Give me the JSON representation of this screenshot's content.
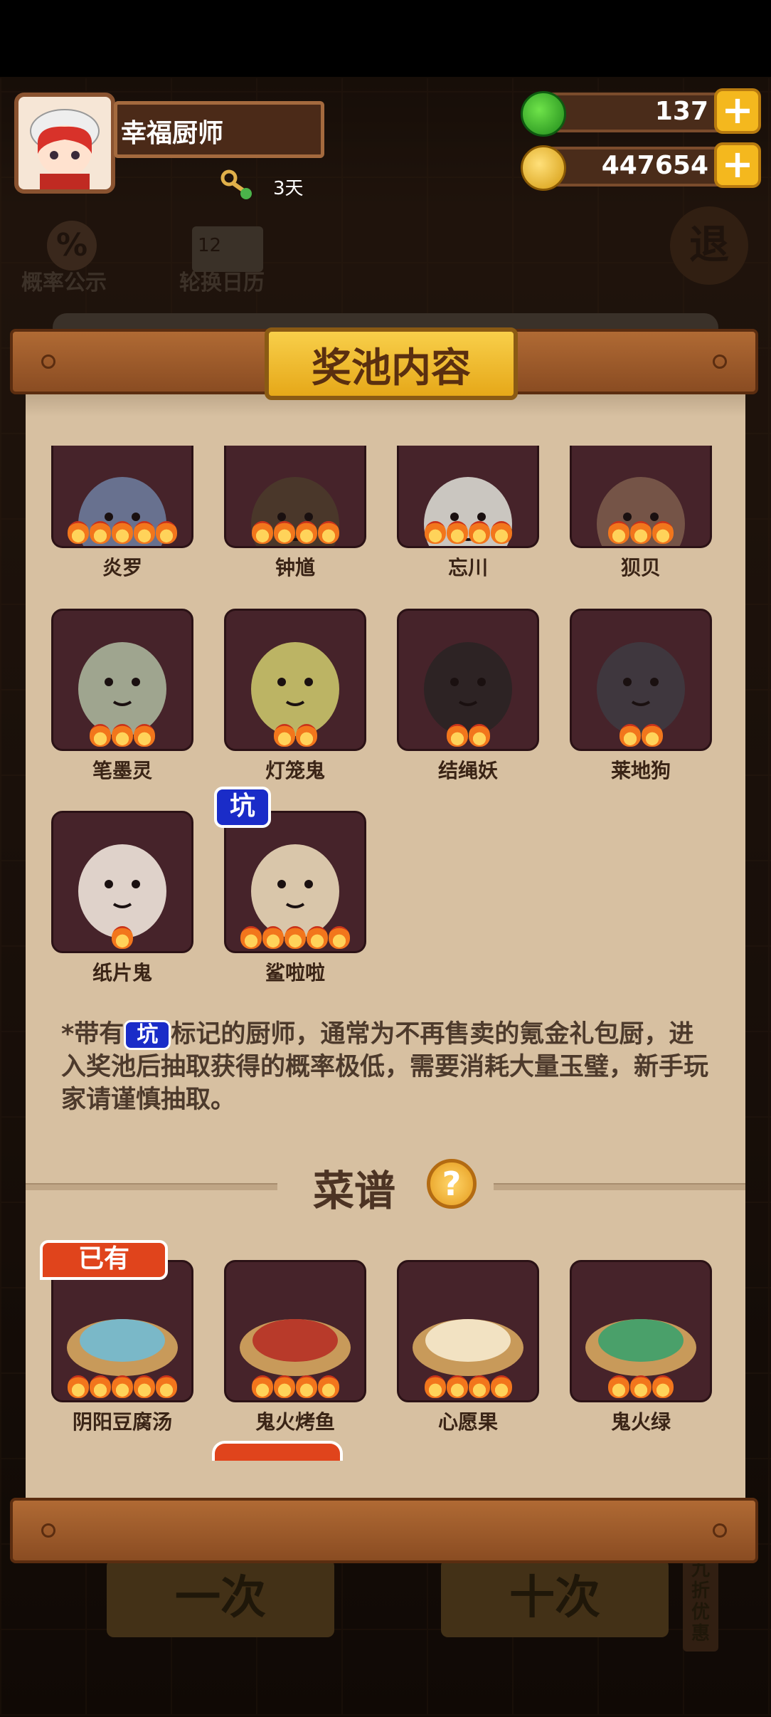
{
  "header": {
    "player_name": "幸福厨师",
    "days": "3天",
    "jade_amount": "137",
    "coin_amount": "447654",
    "plus": "+"
  },
  "background": {
    "prob_label": "概率公示",
    "calendar_label": "轮换日历",
    "calendar_num": "12",
    "exit_label": "退",
    "discount_label": "九折优惠",
    "draw_once": "一次",
    "draw_ten": "十次"
  },
  "panel": {
    "title": "奖池内容",
    "chefs": [
      {
        "name": "炎罗",
        "stars": 5
      },
      {
        "name": "钟馗",
        "stars": 4
      },
      {
        "name": "忘川",
        "stars": 4
      },
      {
        "name": "狈贝",
        "stars": 3
      },
      {
        "name": "笔墨灵",
        "stars": 3
      },
      {
        "name": "灯笼鬼",
        "stars": 2
      },
      {
        "name": "结绳妖",
        "stars": 2
      },
      {
        "name": "莱地狗",
        "stars": 2
      },
      {
        "name": "纸片鬼",
        "stars": 1
      },
      {
        "name": "鲨啦啦",
        "stars": 5,
        "badge": "坑"
      }
    ],
    "note_prefix": "*带有",
    "note_badge": "坑",
    "note_suffix": "标记的厨师，通常为不再售卖的氪金礼包厨，进入奖池后抽取获得的概率极低，需要消耗大量玉璧，新手玩家请谨慎抽取。",
    "recipes_title": "菜谱",
    "help": "?",
    "owned_label": "已有",
    "recipes": [
      {
        "name": "阴阳豆腐汤",
        "stars": 5,
        "owned": true
      },
      {
        "name": "鬼火烤鱼",
        "stars": 4
      },
      {
        "name": "心愿果",
        "stars": 4
      },
      {
        "name": "鬼火绿",
        "stars": 3
      }
    ]
  },
  "colors": {
    "panel_bg": "#d7c0a1",
    "title_plate": "#f2bd33",
    "pit_badge": "#1a2cc8",
    "owned_badge": "#e0441c",
    "plus_button": "#f4b81e"
  }
}
